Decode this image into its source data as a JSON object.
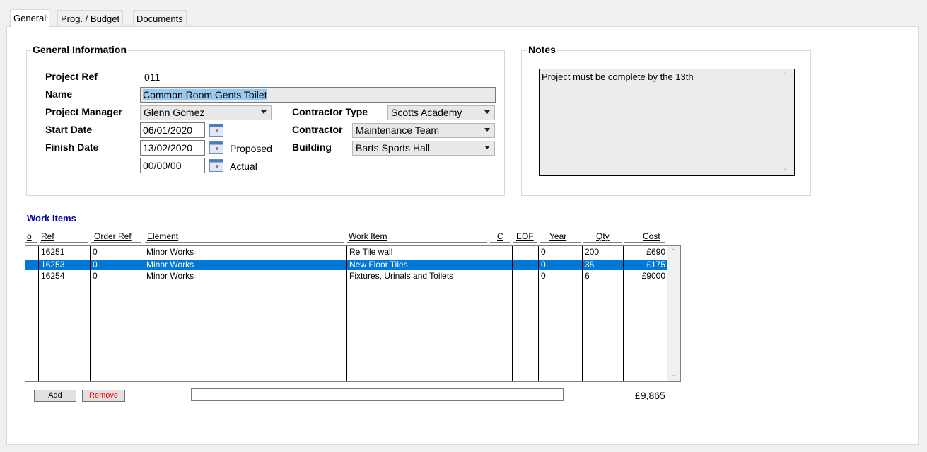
{
  "tabs": [
    "General",
    "Prog. / Budget",
    "Documents"
  ],
  "general_info": {
    "legend": "General Information",
    "project_ref_label": "Project Ref",
    "project_ref": "011",
    "name_label": "Name",
    "name": "Common Room Gents Toilet",
    "project_manager_label": "Project Manager",
    "project_manager": "Glenn Gomez",
    "start_date_label": "Start Date",
    "start_date": "06/01/2020",
    "finish_date_label": "Finish Date",
    "finish_date": "13/02/2020",
    "proposed_label": "Proposed",
    "actual_date": "00/00/00",
    "actual_label": "Actual",
    "contractor_type_label": "Contractor Type",
    "contractor_type": "Scotts Academy",
    "contractor_label": "Contractor",
    "contractor": "Maintenance Team",
    "building_label": "Building",
    "building": "Barts Sports Hall"
  },
  "notes": {
    "legend": "Notes",
    "text": "Project must be complete by the 13th"
  },
  "work_items": {
    "title": "Work Items",
    "headers": [
      "o",
      "Ref",
      "Order Ref",
      "Element",
      "Work Item",
      "C",
      "EOF",
      "Year",
      "Qty",
      "Cost"
    ],
    "rows": [
      {
        "o": "",
        "ref": "16251",
        "order_ref": "0",
        "element": "Minor Works",
        "work_item": "Re Tile wall",
        "c": "",
        "eof": "",
        "year": "0",
        "qty": "200",
        "cost": "£690"
      },
      {
        "o": "",
        "ref": "16253",
        "order_ref": "0",
        "element": "Minor Works",
        "work_item": "New Floor Tiles",
        "c": "",
        "eof": "",
        "year": "0",
        "qty": "35",
        "cost": "£175"
      },
      {
        "o": "",
        "ref": "16254",
        "order_ref": "0",
        "element": "Minor Works",
        "work_item": "Fixtures, Urinals and Toilets",
        "c": "",
        "eof": "",
        "year": "0",
        "qty": "6",
        "cost": "£9000"
      }
    ],
    "add_label": "Add",
    "remove_label": "Remove",
    "total": "£9,865"
  },
  "colors": {
    "selection": "#0078d7",
    "header_blue": "#0000a0",
    "remove_red": "#ff0000"
  }
}
